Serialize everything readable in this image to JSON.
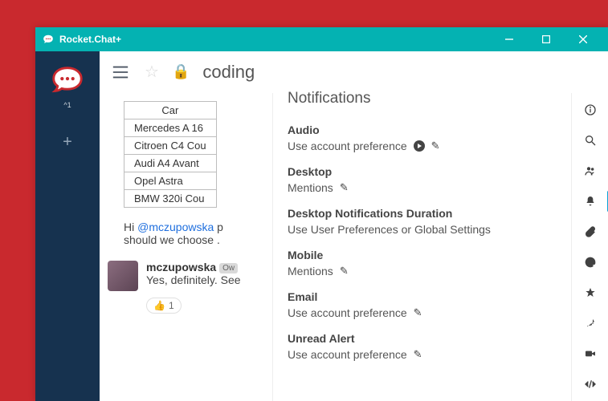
{
  "window": {
    "title": "Rocket.Chat+"
  },
  "sidebar": {
    "unread": "^1"
  },
  "header": {
    "channel": "coding"
  },
  "chat": {
    "tableHeader": "Car",
    "cars": [
      "Mercedes A 16",
      "Citroen C4 Cou",
      "Audi A4 Avant",
      "Opel Astra",
      "BMW 320i Cou"
    ],
    "line1a": "Hi ",
    "mention": "@mczupowska",
    "line1b": " p",
    "line2": "should we choose .",
    "user": "mczupowska",
    "role": "Ow",
    "reply": "Yes, definitely. See",
    "reaction_emoji": "👍",
    "reaction_count": "1"
  },
  "panel": {
    "title": "Notifications",
    "sections": [
      {
        "label": "Audio",
        "value": "Use account preference",
        "icons": [
          "play",
          "edit"
        ]
      },
      {
        "label": "Desktop",
        "value": "Mentions",
        "icons": [
          "edit"
        ]
      },
      {
        "label": "Desktop Notifications Duration",
        "value": "Use User Preferences or Global Settings",
        "icons": []
      },
      {
        "label": "Mobile",
        "value": "Mentions",
        "icons": [
          "edit"
        ]
      },
      {
        "label": "Email",
        "value": "Use account preference",
        "icons": [
          "edit"
        ]
      },
      {
        "label": "Unread Alert",
        "value": "Use account preference",
        "icons": [
          "edit"
        ]
      }
    ]
  }
}
